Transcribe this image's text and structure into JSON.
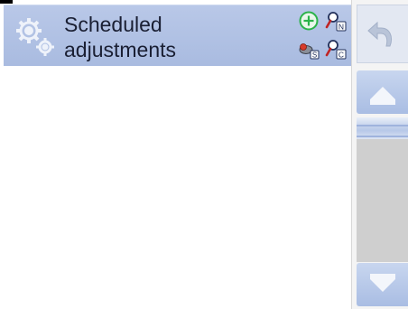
{
  "header": {
    "title_line1": "Scheduled",
    "title_line2": "adjustments",
    "icon": "gears-icon"
  },
  "toolbar": {
    "add": {
      "icon": "add-circle-icon"
    },
    "search_name": {
      "icon": "search-by-name-icon",
      "letter": "N"
    },
    "filter": {
      "icon": "filter-icon",
      "letter": "S"
    },
    "search_code": {
      "icon": "search-by-code-icon",
      "letter": "C"
    }
  },
  "scrollbar": {
    "back": {
      "icon": "undo-arrow-icon"
    },
    "up": {
      "icon": "scroll-up-icon"
    },
    "down": {
      "icon": "scroll-down-icon"
    },
    "position": 0,
    "visible_fraction": 0.15
  },
  "list": {
    "items": []
  },
  "colors": {
    "header_bg": "#b0c1e4",
    "button_bg": "#b5c6e8",
    "track_bg": "#cfcfcf",
    "add_green": "#2bb34a"
  }
}
